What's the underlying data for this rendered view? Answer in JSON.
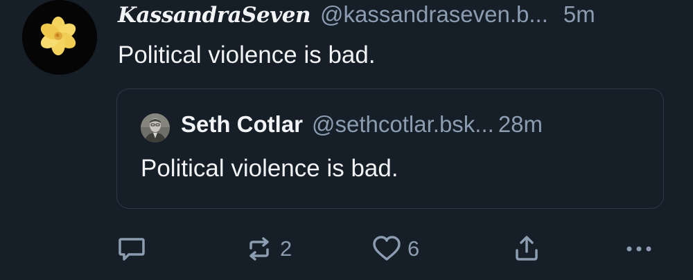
{
  "post": {
    "author_display_name": "KassandraSeven",
    "author_handle": "@kassandraseven.b...",
    "timestamp": "5m",
    "text": "Political violence is bad.",
    "avatar_icon": "yellow-flower-icon"
  },
  "quoted_post": {
    "author_display_name": "Seth Cotlar",
    "author_handle": "@sethcotlar.bsk...",
    "timestamp": "28m",
    "text": "Political violence is bad.",
    "avatar_icon": "person-photo-icon"
  },
  "actions": {
    "reply_icon": "speech-bubble-icon",
    "repost_icon": "repost-arrows-icon",
    "repost_count": "2",
    "like_icon": "heart-icon",
    "like_count": "6",
    "share_icon": "share-icon",
    "more_icon": "ellipsis-icon"
  },
  "colors": {
    "background": "#161e27",
    "primary_text": "#f1f3f5",
    "secondary_text": "#8c9db2",
    "card_border": "#2c3a4a"
  }
}
